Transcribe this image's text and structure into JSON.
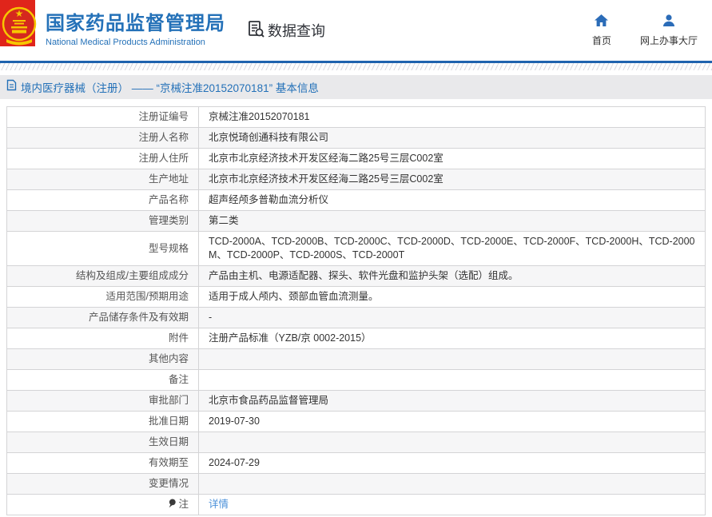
{
  "header": {
    "org_title": "国家药品监督管理局",
    "org_subtitle": "National Medical Products Administration",
    "section_label": "数据查询",
    "nav": [
      {
        "label": "首页",
        "icon": "home-icon"
      },
      {
        "label": "网上办事大厅",
        "icon": "user-icon"
      }
    ]
  },
  "breadcrumb": {
    "text": "境内医疗器械（注册） —— “京械注准20152070181” 基本信息"
  },
  "table": {
    "rows": [
      {
        "label": "注册证编号",
        "value": "京械注准20152070181"
      },
      {
        "label": "注册人名称",
        "value": "北京悦琦创通科技有限公司"
      },
      {
        "label": "注册人住所",
        "value": "北京市北京经济技术开发区经海二路25号三层C002室"
      },
      {
        "label": "生产地址",
        "value": "北京市北京经济技术开发区经海二路25号三层C002室"
      },
      {
        "label": "产品名称",
        "value": "超声经颅多普勒血流分析仪"
      },
      {
        "label": "管理类别",
        "value": "第二类"
      },
      {
        "label": "型号规格",
        "value": "TCD-2000A、TCD-2000B、TCD-2000C、TCD-2000D、TCD-2000E、TCD-2000F、TCD-2000H、TCD-2000M、TCD-2000P、TCD-2000S、TCD-2000T"
      },
      {
        "label": "结构及组成/主要组成成分",
        "value": "产品由主机、电源适配器、探头、软件光盘和监护头架（选配）组成。"
      },
      {
        "label": "适用范围/预期用途",
        "value": "适用于成人颅内、颈部血管血流测量。"
      },
      {
        "label": "产品储存条件及有效期",
        "value": "-"
      },
      {
        "label": "附件",
        "value": "注册产品标准（YZB/京 0002-2015）"
      },
      {
        "label": "其他内容",
        "value": ""
      },
      {
        "label": "备注",
        "value": ""
      },
      {
        "label": "审批部门",
        "value": "北京市食品药品监督管理局"
      },
      {
        "label": "批准日期",
        "value": "2019-07-30"
      },
      {
        "label": "生效日期",
        "value": ""
      },
      {
        "label": "有效期至",
        "value": "2024-07-29"
      },
      {
        "label": "变更情况",
        "value": ""
      },
      {
        "label": "注",
        "value": "详情",
        "link": true,
        "label_icon": "pin-icon"
      }
    ]
  },
  "colors": {
    "accent_blue": "#2471b8",
    "divider_blue": "#1e62ae",
    "link_blue": "#4a90d9",
    "emblem_red": "#e0251b",
    "emblem_gold": "#f7c600",
    "strip_gray": "#e9e9eb"
  }
}
